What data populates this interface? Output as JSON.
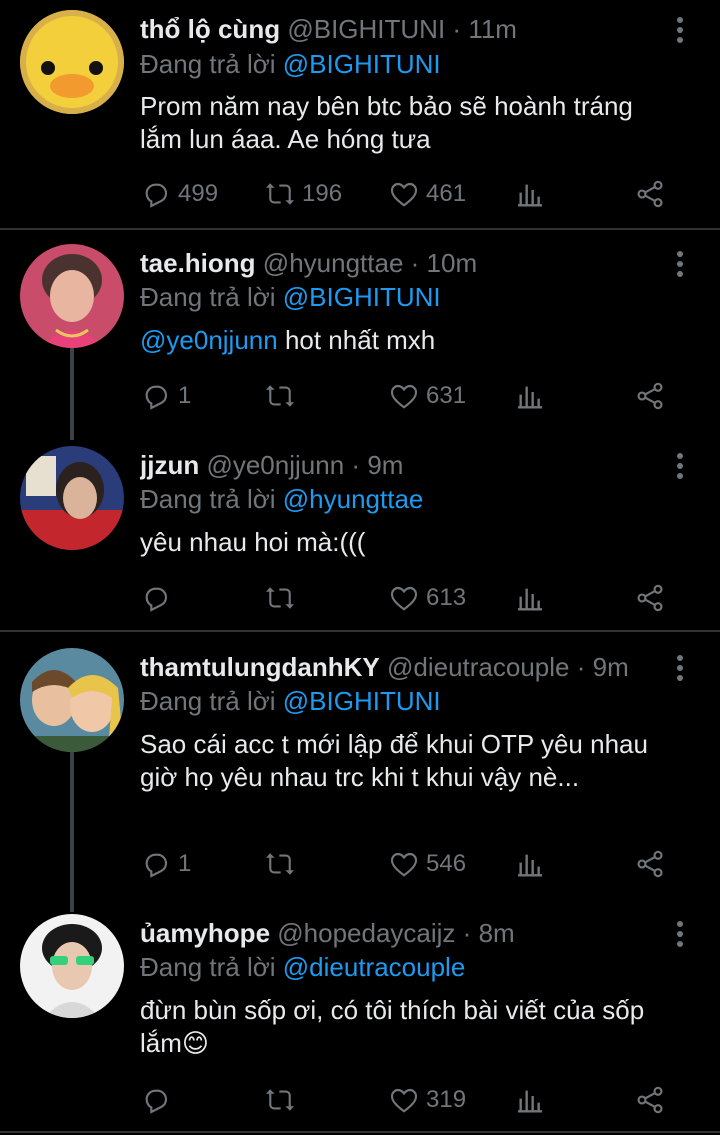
{
  "reply_prefix": "Đang trả lời ",
  "tweets": [
    {
      "name": "thổ lộ cùng",
      "handle": "@BIGHITUNI",
      "time": "11m",
      "reply_to": "@BIGHITUNI",
      "mention": "",
      "text_line1": "Prom năm nay bên btc bảo sẽ hoành tráng",
      "text_line2": "lắm lun áaa. Ae hóng tưa",
      "replies": "499",
      "retweets": "196",
      "likes": "461",
      "avatar": "duck-avatar"
    },
    {
      "name": "tae.hiong",
      "handle": "@hyungttae",
      "time": "10m",
      "reply_to": "@BIGHITUNI",
      "mention": "@ye0njjunn",
      "text_line1": " hot nhất mxh",
      "text_line2": "",
      "replies": "1",
      "retweets": "",
      "likes": "631",
      "avatar": "person-avatar"
    },
    {
      "name": "jjzun",
      "handle": "@ye0njjunn",
      "time": "9m",
      "reply_to": "@hyungttae",
      "mention": "",
      "text_line1": "yêu nhau hoi mà:(((",
      "text_line2": "",
      "replies": "",
      "retweets": "",
      "likes": "613",
      "avatar": "person-avatar"
    },
    {
      "name": "thamtulungdanhKY",
      "handle": "@dieutracouple",
      "time": "9m",
      "reply_to": "@BIGHITUNI",
      "mention": "",
      "text_line1": "Sao cái acc t mới lập để khui OTP yêu nhau",
      "text_line2": "giờ họ yêu nhau trc khi t khui vậy nè...",
      "replies": "1",
      "retweets": "",
      "likes": "546",
      "avatar": "cartoon-avatar"
    },
    {
      "name": "ủamyhope",
      "handle": "@hopedaycaijz",
      "time": "8m",
      "reply_to": "@dieutracouple",
      "mention": "",
      "text_line1": "đừn bùn sốp ơi, có tôi thích bài viết của sốp",
      "text_line2": "lắm😊",
      "replies": "",
      "retweets": "",
      "likes": "319",
      "avatar": "person-avatar"
    }
  ],
  "separator_dot": "·",
  "colors": {
    "background": "#000000",
    "text": "#e7e9ea",
    "muted": "#71767b",
    "link": "#1d9bf0",
    "divider": "#2f3336"
  }
}
